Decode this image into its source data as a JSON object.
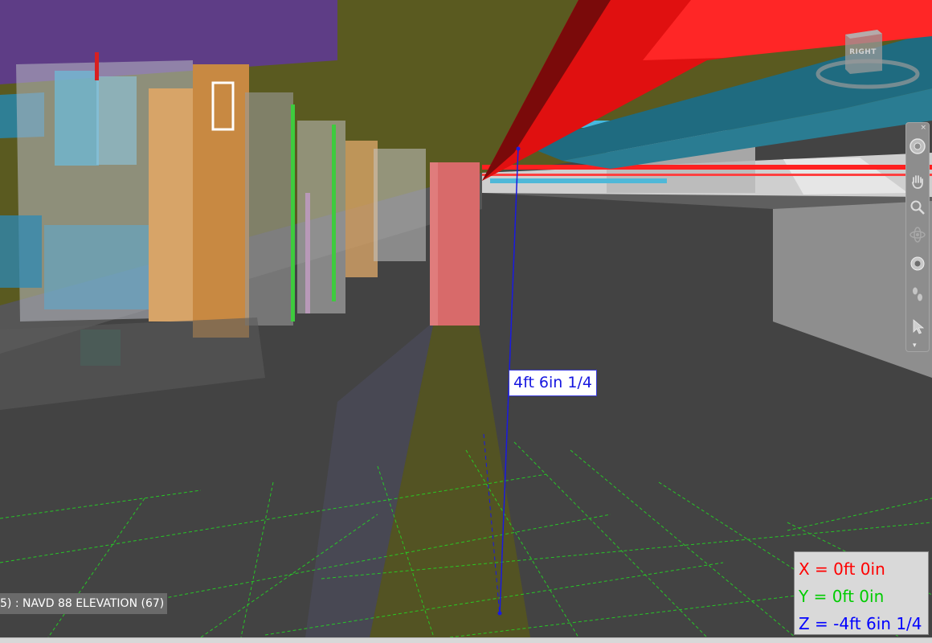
{
  "measurement": {
    "label": "4ft 6in 1/4"
  },
  "level": {
    "label": "5) : NAVD 88 ELEVATION (67)"
  },
  "coordinates": {
    "x": "X = 0ft 0in",
    "y": "Y = 0ft 0in",
    "z": "Z = -4ft 6in 1/4",
    "x_color": "#ff0000",
    "y_color": "#00cc00",
    "z_color": "#0000ff"
  },
  "viewcube": {
    "face_label": "RIGHT"
  },
  "navigation_bar": {
    "close_glyph": "×",
    "expand_glyph": "▾",
    "tools": [
      {
        "name": "full-navigation-wheel-icon"
      },
      {
        "name": "pan-icon"
      },
      {
        "name": "zoom-icon"
      },
      {
        "name": "orbit-icon"
      },
      {
        "name": "look-icon"
      },
      {
        "name": "walk-icon"
      },
      {
        "name": "select-icon"
      }
    ]
  },
  "colors": {
    "floor": "#434343",
    "beam_red": "#ff1010",
    "duct_teal": "#1f6b80",
    "measure_line": "#1a1ae0",
    "grid_green": "#22dd22",
    "column_pink": "#d86a6a",
    "corridor_olive": "#5a5a1c"
  }
}
